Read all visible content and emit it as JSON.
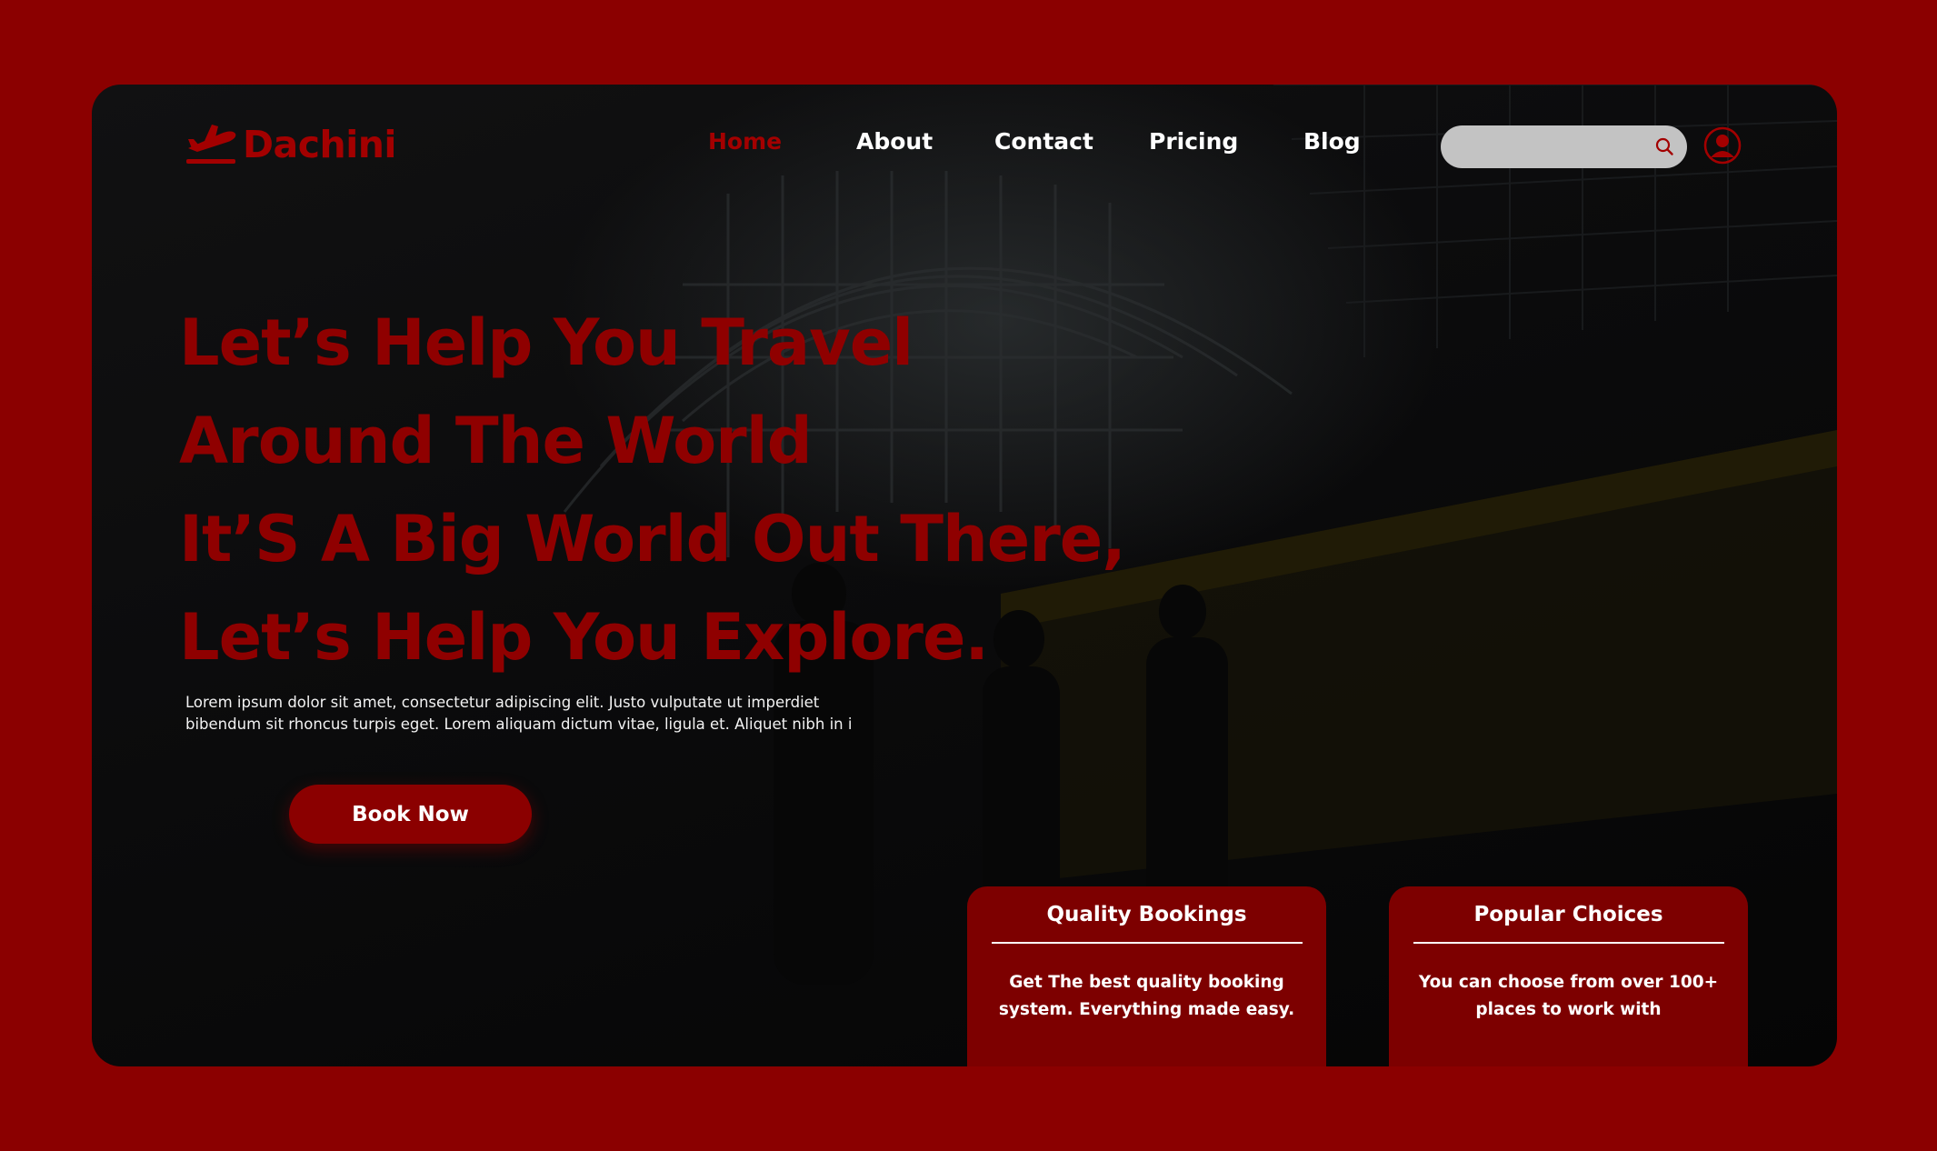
{
  "brand": {
    "name": "Dachini",
    "color": "#a30000",
    "icon": "plane-logo-icon"
  },
  "nav": {
    "items": [
      {
        "label": "Home",
        "active": true
      },
      {
        "label": "About",
        "active": false
      },
      {
        "label": "Contact",
        "active": false
      },
      {
        "label": "Pricing",
        "active": false
      },
      {
        "label": "Blog",
        "active": false
      }
    ],
    "active_color": "#a30000"
  },
  "search": {
    "placeholder": "",
    "value": "",
    "icon": "search-icon"
  },
  "user": {
    "icon": "user-avatar-icon"
  },
  "hero": {
    "headline": [
      "Let’s Help You Travel",
      "Around The World",
      "It’S A Big World Out There,",
      "Let’s Help You Explore."
    ],
    "body": "Lorem ipsum dolor sit amet, consectetur adipiscing elit. Justo vulputate ut imperdiet bibendum sit rhoncus turpis eget. Lorem aliquam dictum vitae, ligula et. Aliquet nibh in i",
    "cta_label": "Book Now"
  },
  "cards": [
    {
      "title": "Quality Bookings",
      "body": "Get The best quality booking system. Everything made easy."
    },
    {
      "title": "Popular Choices",
      "body": "You can choose from over 100+ places to work with"
    }
  ],
  "colors": {
    "page_background": "#8b0000",
    "accent": "#8f0000",
    "card": "#7d0000"
  }
}
